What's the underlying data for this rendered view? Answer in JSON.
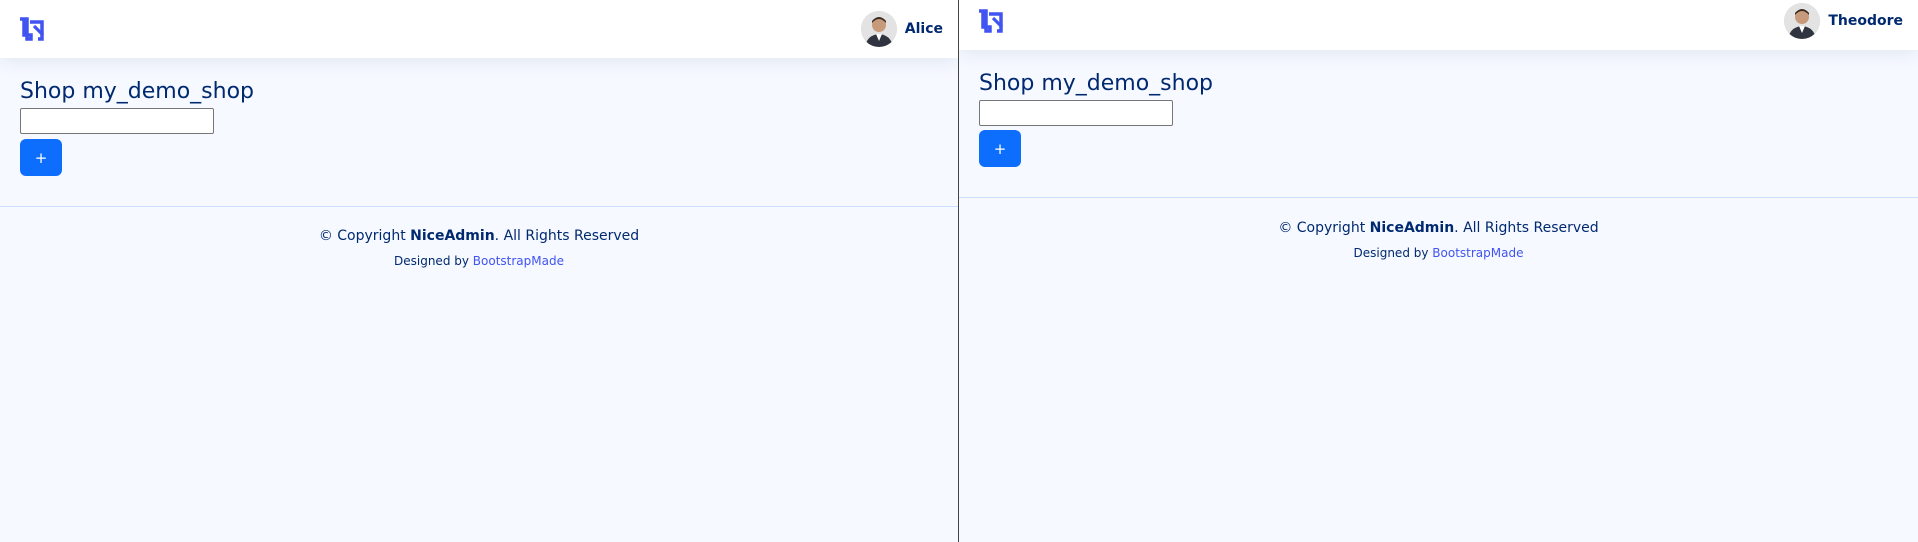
{
  "panes": [
    {
      "user": {
        "name": "Alice"
      },
      "page": {
        "title": "Shop my_demo_shop",
        "input_value": "",
        "add_label": "+"
      },
      "footer": {
        "copyright_prefix": "© Copyright ",
        "brand": "NiceAdmin",
        "copyright_suffix": ". All Rights Reserved",
        "designed_by": "Designed by ",
        "designer_link": "BootstrapMade"
      }
    },
    {
      "user": {
        "name": "Theodore"
      },
      "page": {
        "title": "Shop my_demo_shop",
        "input_value": "",
        "add_label": "+"
      },
      "footer": {
        "copyright_prefix": "© Copyright ",
        "brand": "NiceAdmin",
        "copyright_suffix": ". All Rights Reserved",
        "designed_by": "Designed by ",
        "designer_link": "BootstrapMade"
      }
    }
  ],
  "icons": {
    "logo": "niceadmin-logo-icon",
    "avatar": "user-avatar"
  },
  "colors": {
    "header_bg": "#ffffff",
    "page_bg": "#f6f9ff",
    "text_primary": "#012970",
    "button_primary": "#0d6efd",
    "link": "#4154f1",
    "logo": "#4154f1"
  }
}
